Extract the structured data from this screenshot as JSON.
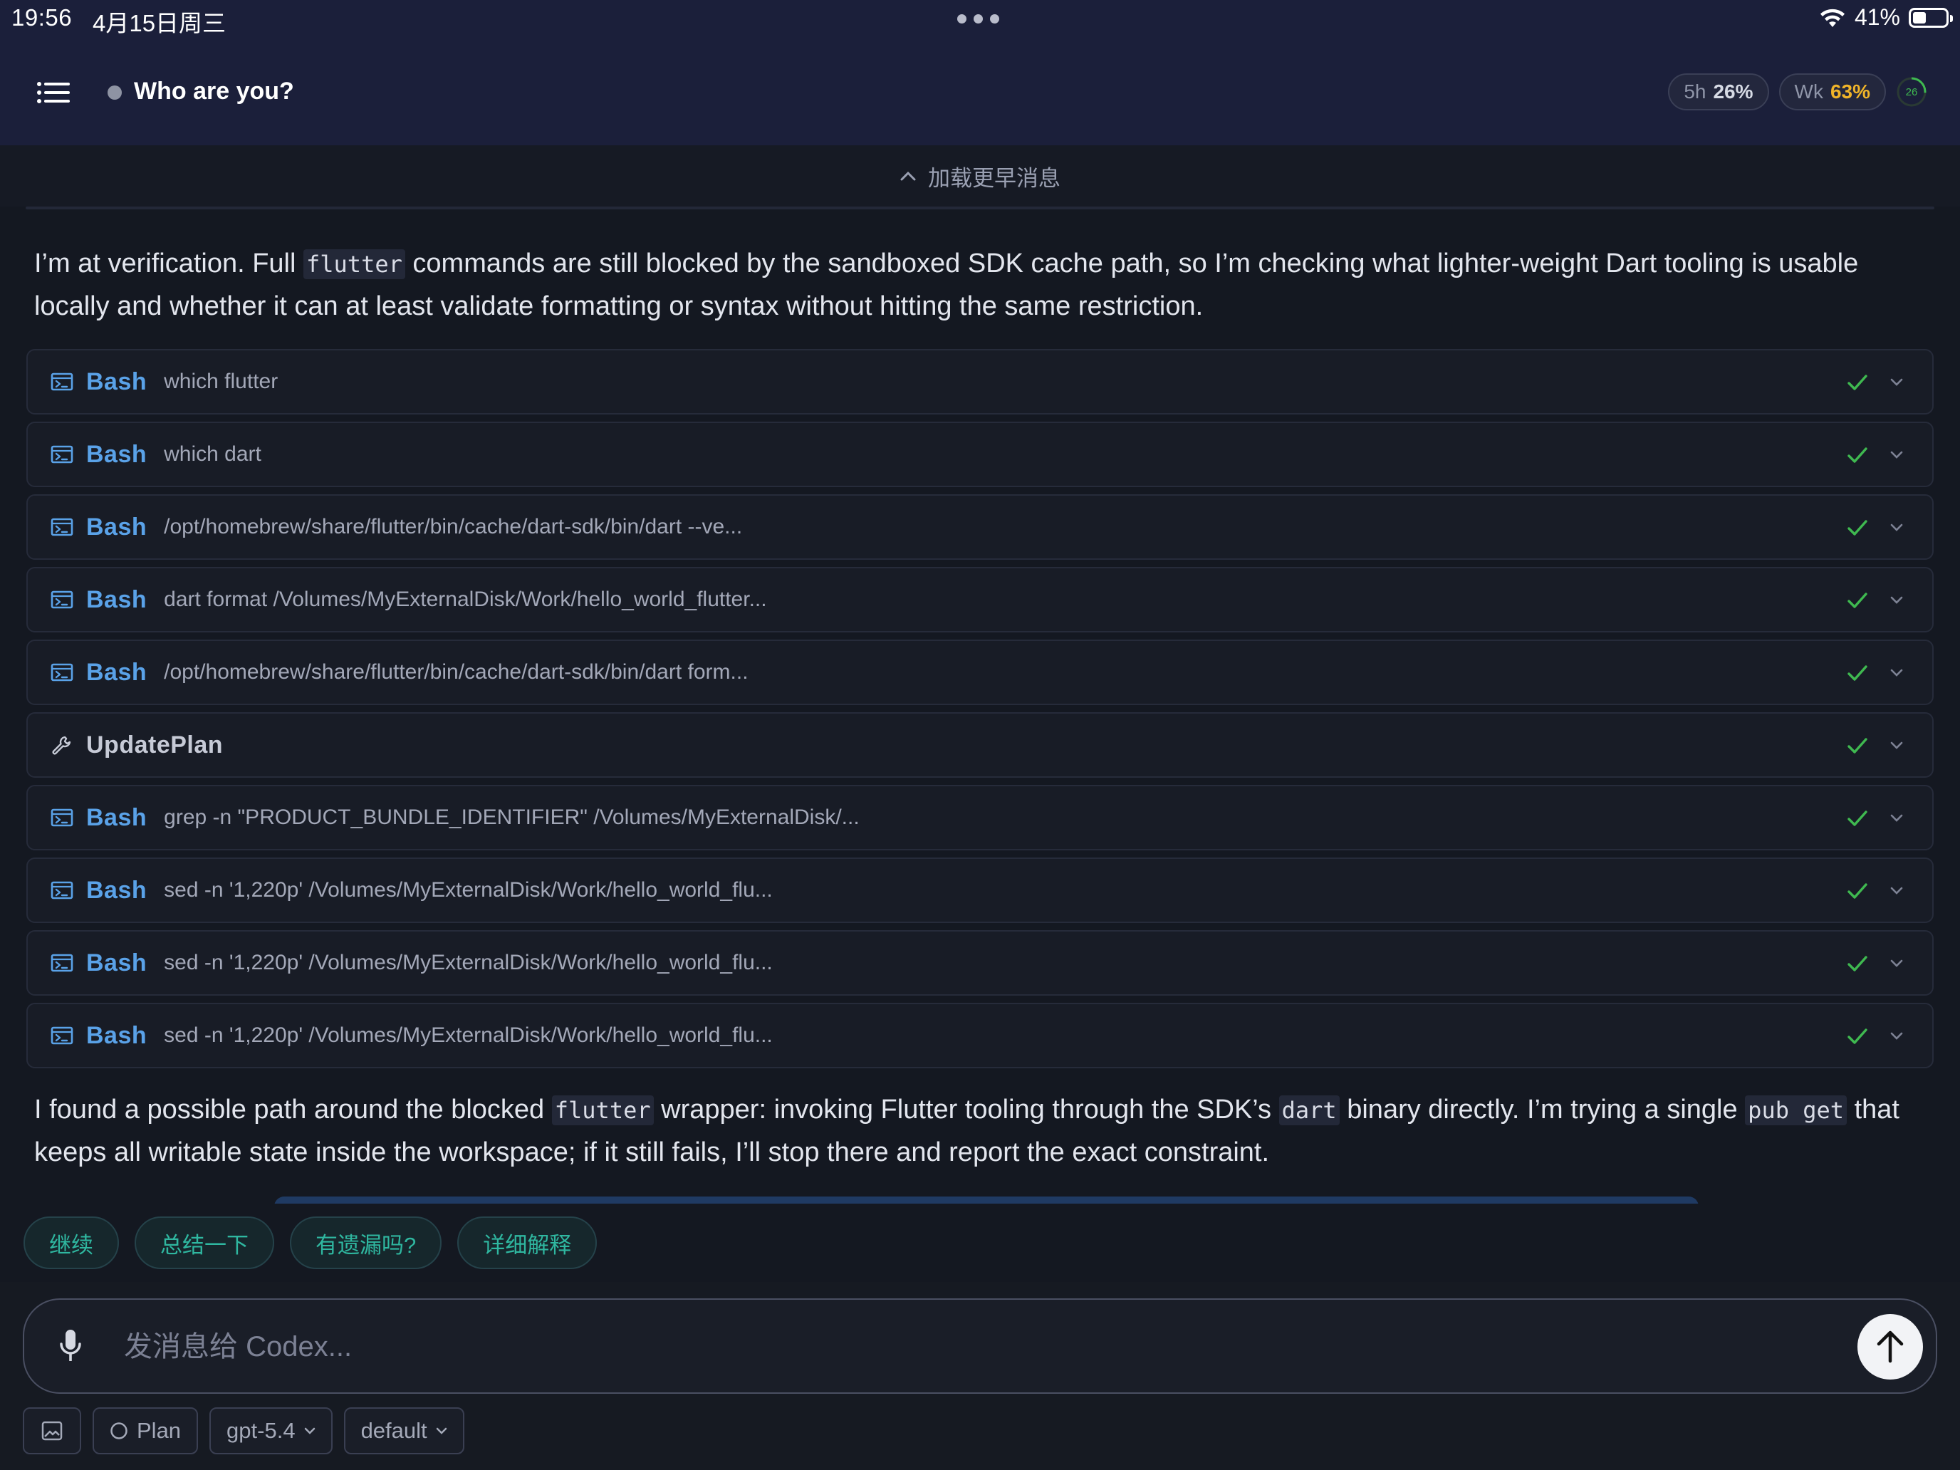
{
  "status_bar": {
    "time": "19:56",
    "date": "4月15日周三",
    "battery": "41%"
  },
  "header": {
    "conversation_title": "Who are you?",
    "usage": [
      {
        "label": "5h",
        "value": "26%"
      },
      {
        "label": "Wk",
        "value": "63%"
      }
    ],
    "ring_value": "26"
  },
  "load_earlier": "加载更早消息",
  "messages": {
    "first": {
      "before": "I’m at verification. Full ",
      "code": "flutter",
      "after": " commands are still blocked by the sandboxed SDK cache path, so I’m checking what lighter-weight Dart tooling is usable locally and whether it can at least validate formatting or syntax without hitting the same restriction."
    },
    "second": {
      "p1": "I found a possible path around the blocked ",
      "c1": "flutter",
      "p2": " wrapper: invoking Flutter tooling through the SDK’s ",
      "c2": "dart",
      "p3": " binary directly. I’m trying a single ",
      "c3": "pub get",
      "p4": " that keeps all writable state inside the workspace; if it still fails, I’ll stop there and report the exact constraint."
    }
  },
  "tools": [
    {
      "name": "Bash",
      "cmd": "which flutter",
      "icon": "terminal-icon"
    },
    {
      "name": "Bash",
      "cmd": "which dart",
      "icon": "terminal-icon"
    },
    {
      "name": "Bash",
      "cmd": "/opt/homebrew/share/flutter/bin/cache/dart-sdk/bin/dart --ve...",
      "icon": "terminal-icon"
    },
    {
      "name": "Bash",
      "cmd": "dart format /Volumes/MyExternalDisk/Work/hello_world_flutter...",
      "icon": "terminal-icon"
    },
    {
      "name": "Bash",
      "cmd": "/opt/homebrew/share/flutter/bin/cache/dart-sdk/bin/dart form...",
      "icon": "terminal-icon"
    },
    {
      "name": "UpdatePlan",
      "cmd": "",
      "icon": "wrench-icon"
    },
    {
      "name": "Bash",
      "cmd": "grep -n \"PRODUCT_BUNDLE_IDENTIFIER\" /Volumes/MyExternalDisk/...",
      "icon": "terminal-icon"
    },
    {
      "name": "Bash",
      "cmd": "sed -n '1,220p' /Volumes/MyExternalDisk/Work/hello_world_flu...",
      "icon": "terminal-icon"
    },
    {
      "name": "Bash",
      "cmd": "sed -n '1,220p' /Volumes/MyExternalDisk/Work/hello_world_flu...",
      "icon": "terminal-icon"
    },
    {
      "name": "Bash",
      "cmd": "sed -n '1,220p' /Volumes/MyExternalDisk/Work/hello_world_flu...",
      "icon": "terminal-icon"
    }
  ],
  "quick_replies": [
    "继续",
    "总结一下",
    "有遗漏吗?",
    "详细解释"
  ],
  "composer": {
    "placeholder": "发消息给 Codex...",
    "value": ""
  },
  "toolbar": {
    "plan_label": "Plan",
    "model_label": "gpt-5.4",
    "mode_label": "default"
  },
  "colors": {
    "header_bg": "#1b1f3a",
    "tool_name": "#5aa2e8",
    "success": "#3fb950",
    "chip_text": "#2fb7a0",
    "warn": "#f0b429"
  }
}
